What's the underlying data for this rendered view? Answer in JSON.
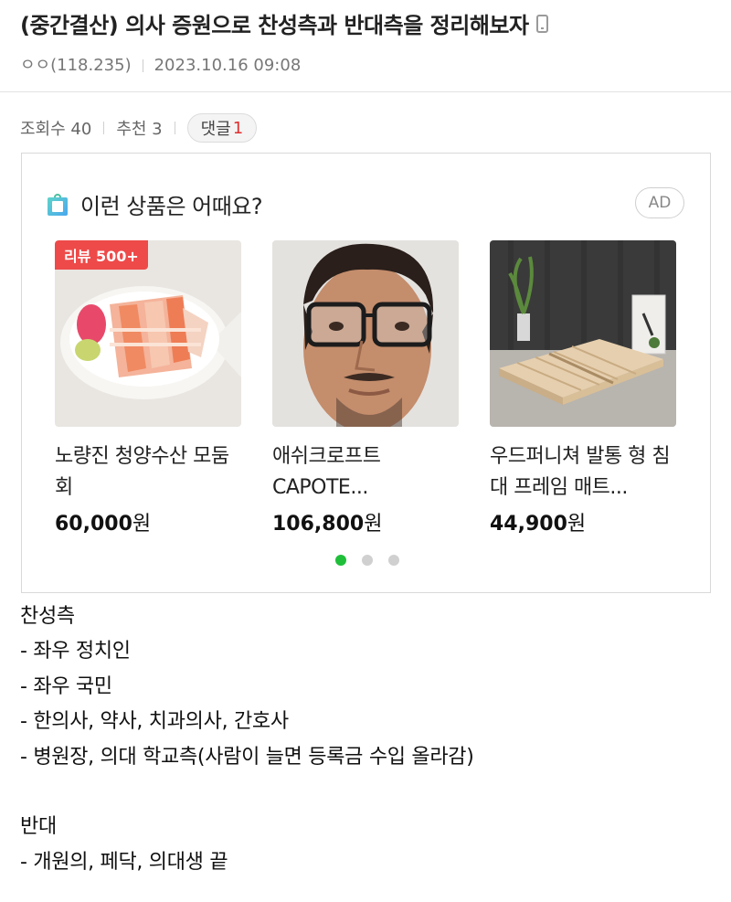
{
  "post": {
    "title": "(중간결산) 의사 증원으로 찬성측과 반대측을 정리해보자",
    "author": "ㅇㅇ(118.235)",
    "datetime": "2023.10.16 09:08"
  },
  "stats": {
    "views": "조회수 40",
    "recommend": "추천 3",
    "comments_label": "댓글",
    "comments_count": "1"
  },
  "ad": {
    "heading": "이런 상품은 어때요?",
    "badge": "AD",
    "products": [
      {
        "name": "노량진 청양수산 모둠회",
        "price": "60,000",
        "currency": "원",
        "badge": "리뷰 500+"
      },
      {
        "name": "애쉬크로프트 CAPOTE...",
        "price": "106,800",
        "currency": "원"
      },
      {
        "name": "우드퍼니쳐 발통 형 침대 프레임 매트...",
        "price": "44,900",
        "currency": "원"
      }
    ],
    "carousel": {
      "total": 3,
      "active": 1
    },
    "colors": {
      "badge": "#ee4a4a",
      "active_dot": "#1fbf3a"
    }
  },
  "content": {
    "lines": [
      "찬성측",
      "- 좌우 정치인",
      "- 좌우 국민",
      "- 한의사, 약사, 치과의사, 간호사",
      "- 병원장, 의대 학교측(사람이 늘면 등록금 수입 올라감)",
      "",
      "반대",
      "- 개원의, 페닥, 의대생  끝"
    ]
  },
  "icons": [
    "mobile-icon",
    "shopping-bag-icon"
  ]
}
